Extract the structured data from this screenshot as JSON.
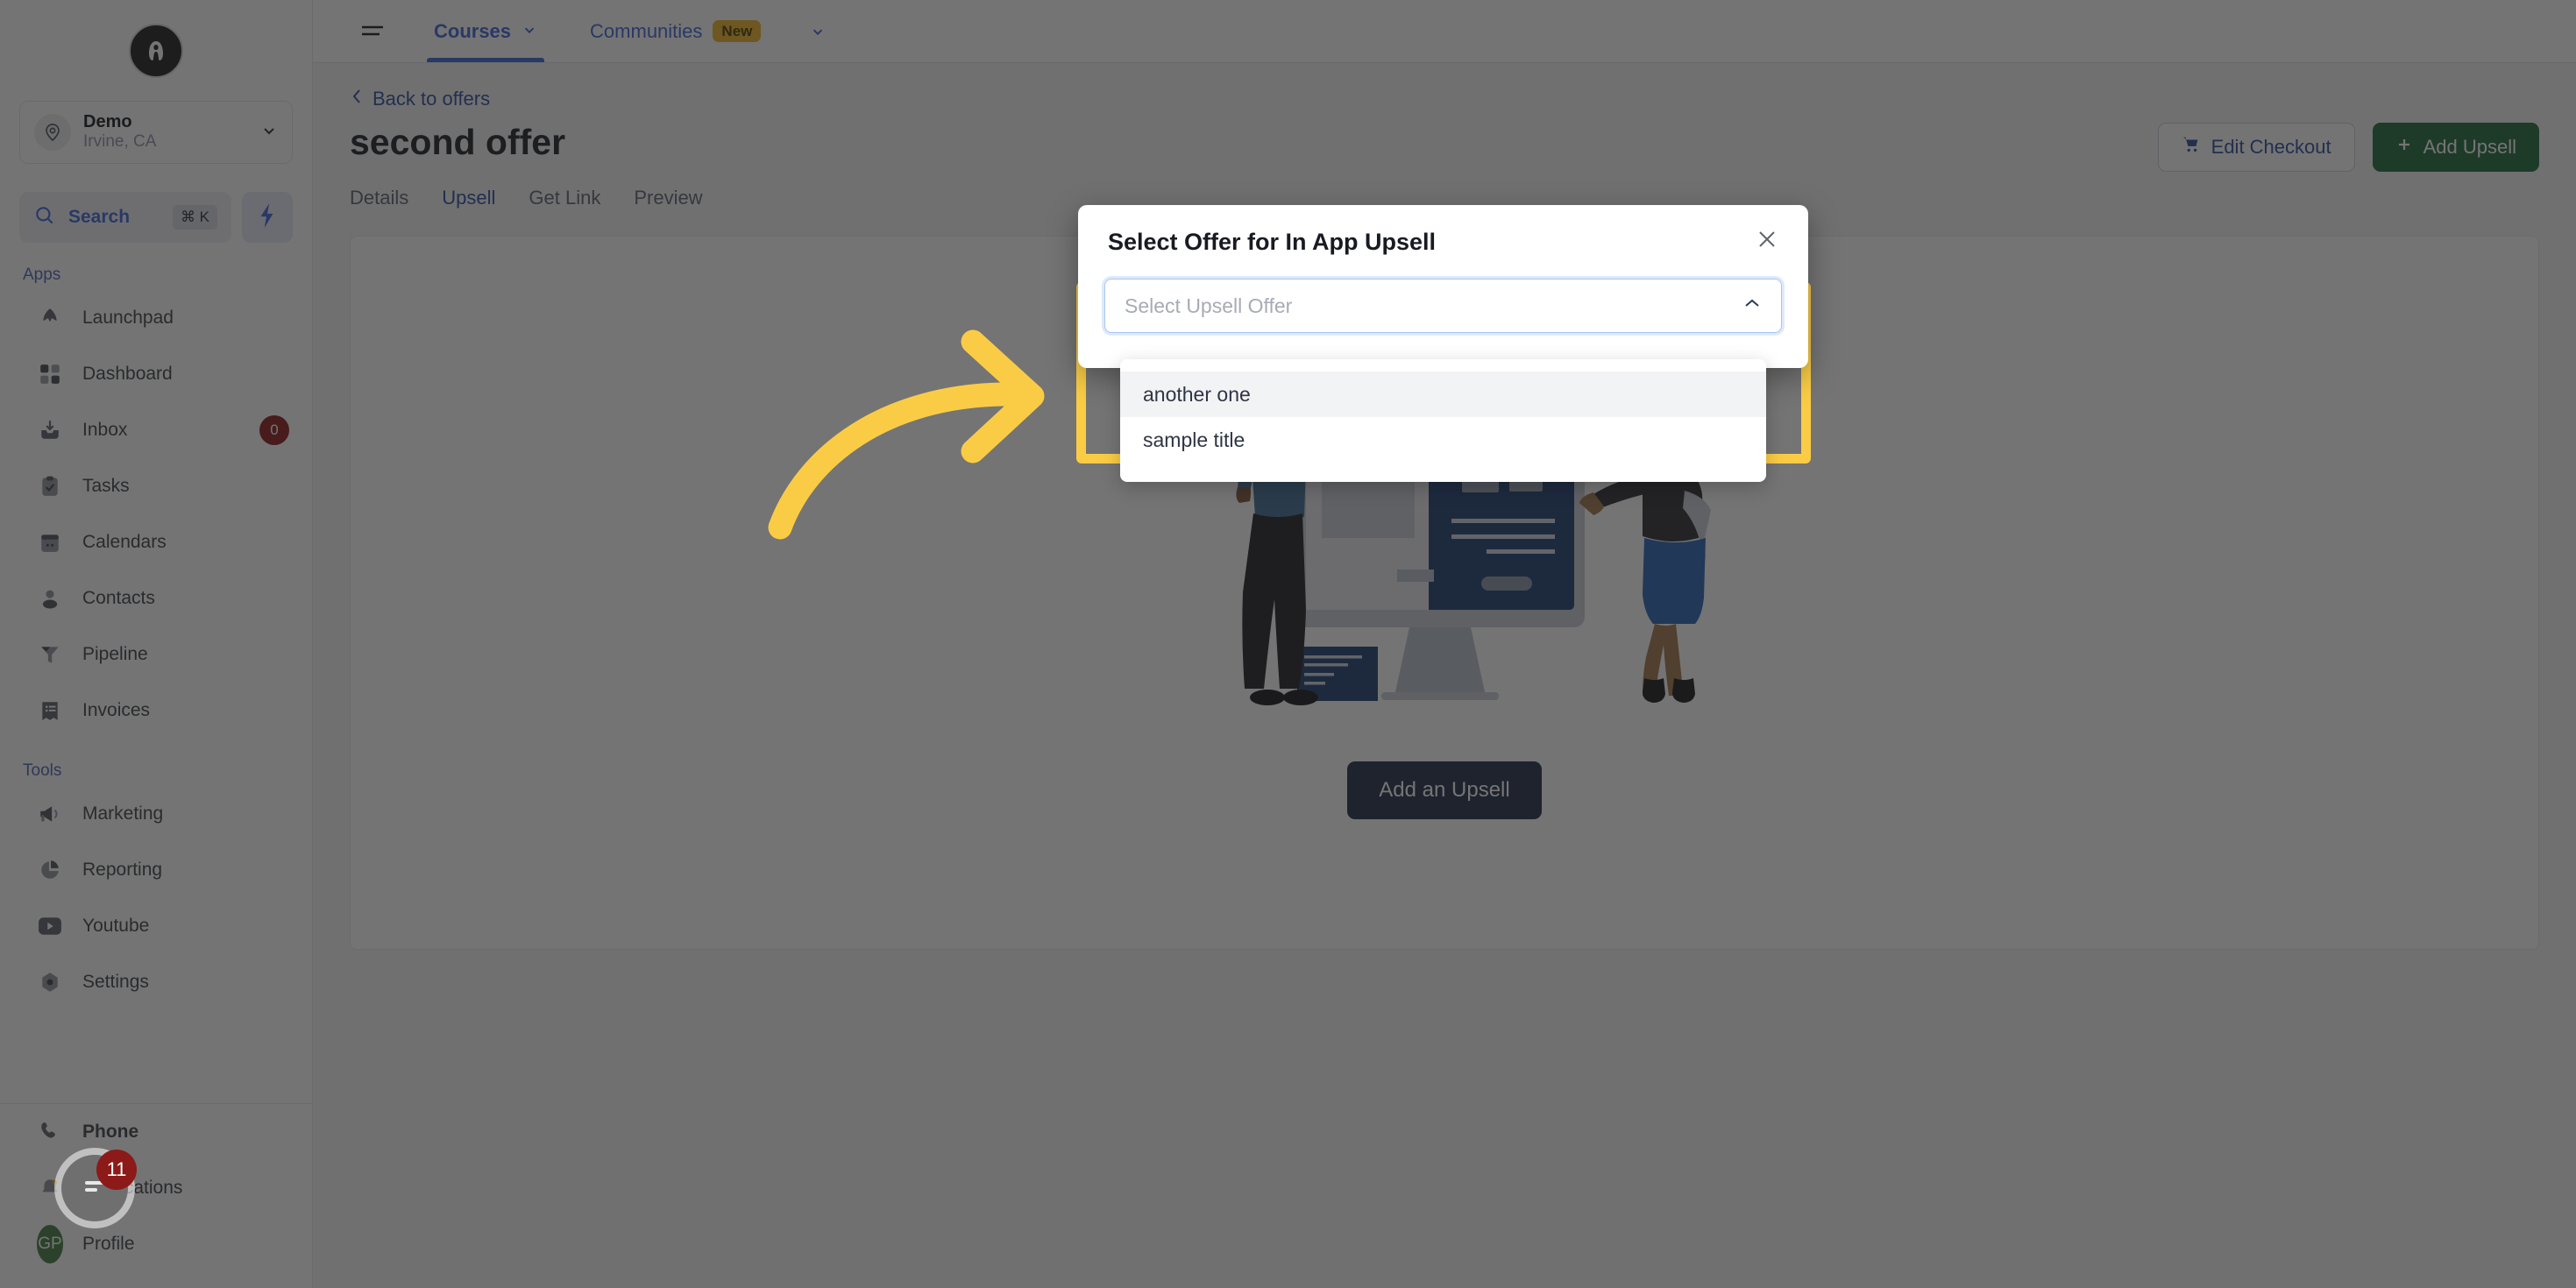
{
  "brand": {
    "logo_letter": "A",
    "accent_blue": "#3a64d8",
    "highlight_yellow": "#facc45",
    "danger_red": "#8b1a18",
    "green": "#1f6b3b"
  },
  "sidebar": {
    "location": {
      "name": "Demo",
      "sublabel": "Irvine, CA",
      "pin_icon": "location-pin-icon",
      "chevron_icon": "chevron-down-icon"
    },
    "search": {
      "label": "Search",
      "shortcut": "⌘ K",
      "icon": "search-icon"
    },
    "quick_action": {
      "icon": "lightning-bolt-icon"
    },
    "sections": [
      {
        "title": "Apps",
        "items": [
          {
            "label": "Launchpad",
            "icon": "launchpad-icon",
            "badge": null
          },
          {
            "label": "Dashboard",
            "icon": "dashboard-grid-icon",
            "badge": null
          },
          {
            "label": "Inbox",
            "icon": "inbox-icon",
            "badge": "0"
          },
          {
            "label": "Tasks",
            "icon": "clipboard-check-icon",
            "badge": null
          },
          {
            "label": "Calendars",
            "icon": "calendar-icon",
            "badge": null
          },
          {
            "label": "Contacts",
            "icon": "person-icon",
            "badge": null
          },
          {
            "label": "Pipeline",
            "icon": "funnel-icon",
            "badge": null
          },
          {
            "label": "Invoices",
            "icon": "invoice-list-icon",
            "badge": null
          }
        ]
      },
      {
        "title": "Tools",
        "items": [
          {
            "label": "Marketing",
            "icon": "megaphone-icon",
            "badge": null
          },
          {
            "label": "Reporting",
            "icon": "pie-chart-icon",
            "badge": null
          },
          {
            "label": "Youtube",
            "icon": "youtube-icon",
            "badge": null
          },
          {
            "label": "Settings",
            "icon": "gear-icon",
            "badge": null
          }
        ]
      }
    ],
    "bottom_items": [
      {
        "label": "Phone",
        "icon": "phone-icon",
        "badge": null
      },
      {
        "label": "Notifications",
        "icon": "bell-icon",
        "badge": null
      },
      {
        "label": "Profile",
        "icon": "avatar-icon",
        "avatar_initials": "GP",
        "badge": null
      }
    ]
  },
  "topbar": {
    "menu_icon": "hamburger-menu-icon",
    "tabs": [
      {
        "label": "Courses",
        "active": true,
        "caret": "chevron-down-icon",
        "pill": null
      },
      {
        "label": "Communities",
        "active": false,
        "caret": null,
        "pill": "New"
      }
    ],
    "overflow_caret": "chevron-down-icon"
  },
  "page": {
    "back_link": "Back to offers",
    "back_icon": "chevron-left-icon",
    "title": "second offer",
    "subtabs": [
      {
        "label": "Details",
        "active": false
      },
      {
        "label": "Upsell",
        "active": true
      },
      {
        "label": "Get Link",
        "active": false
      },
      {
        "label": "Preview",
        "active": false
      }
    ],
    "actions": [
      {
        "label": "Edit Checkout",
        "icon": "shopping-cart-icon",
        "style": "outline"
      },
      {
        "label": "Add Upsell",
        "icon": "plus-icon",
        "style": "green"
      }
    ],
    "empty_state": {
      "illustration": "two-people-at-monitor-illustration",
      "cta_label": "Add an Upsell"
    }
  },
  "modal": {
    "title": "Select Offer for In App Upsell",
    "close_icon": "close-x-icon",
    "select": {
      "placeholder": "Select Upsell Offer",
      "value": "",
      "caret_icon": "chevron-up-icon",
      "expanded": true,
      "options": [
        {
          "label": "another one",
          "hovered": true
        },
        {
          "label": "sample title",
          "hovered": false
        }
      ]
    }
  },
  "annotations": {
    "arrow": {
      "icon": "curved-arrow-right-icon",
      "color": "#facc45"
    },
    "highlight_box": {
      "color": "#facc45"
    }
  },
  "chat_widget": {
    "icon": "chat-bubble-icon",
    "unread_count": "11"
  }
}
